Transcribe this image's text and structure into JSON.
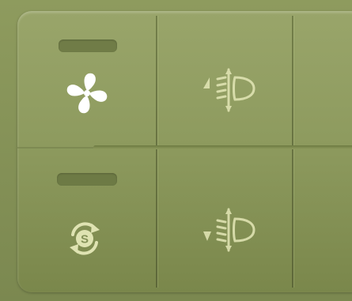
{
  "colors": {
    "panel_top": "#99a56a",
    "panel_bottom": "#7a874b",
    "icon_active": "#ffffff",
    "icon_dim": "#d8dca8",
    "indicator": "#69763f"
  },
  "buttons": [
    {
      "id": "fan",
      "icon": "fan-icon",
      "active": true
    },
    {
      "id": "headlight-up",
      "icon": "headlight-level-up-icon",
      "active": false
    },
    {
      "id": "recirculation",
      "icon": "s-mode-cycle-icon",
      "active": false
    },
    {
      "id": "headlight-down",
      "icon": "headlight-level-down-icon",
      "active": false
    }
  ]
}
